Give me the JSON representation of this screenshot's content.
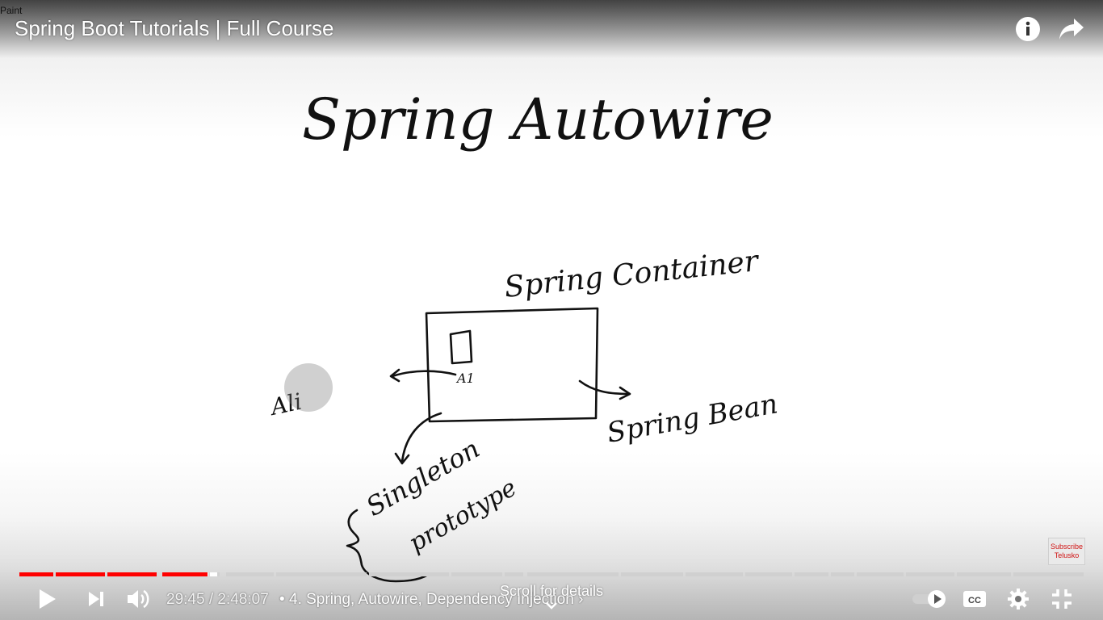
{
  "window": {
    "app_label": "Paint"
  },
  "header": {
    "title": "Spring Boot Tutorials | Full Course"
  },
  "icons": {
    "info": "info-icon",
    "share": "share-icon",
    "play": "play-icon",
    "next": "next-icon",
    "volume": "volume-icon",
    "autoplay": "autoplay-toggle-icon",
    "captions": "captions-icon",
    "settings": "gear-icon",
    "exit_fullscreen": "exit-fullscreen-icon",
    "chevron": "chevron-down-icon"
  },
  "whiteboard": {
    "heading": "Spring Autowire",
    "container_label": "Spring Container",
    "bean_label": "Spring Bean",
    "box_label": "A1",
    "scopes": [
      "Singleton",
      "prototype"
    ],
    "cursor_text": "Ali"
  },
  "watermark": {
    "line1": "Subscribe",
    "line2": "Telusko"
  },
  "player": {
    "current_time": "29:45",
    "separator": " / ",
    "duration": "2:48:07",
    "chapter_bullet": "•",
    "chapter": "4. Spring, Autowire, Dependency Injection",
    "chapter_arrow": "›",
    "scroll_hint": "Scroll for details",
    "played_fraction": 0.177,
    "colors": {
      "played": "#ff0000",
      "buffered": "#ffffff",
      "unplayed": "#d0d0d0"
    }
  }
}
